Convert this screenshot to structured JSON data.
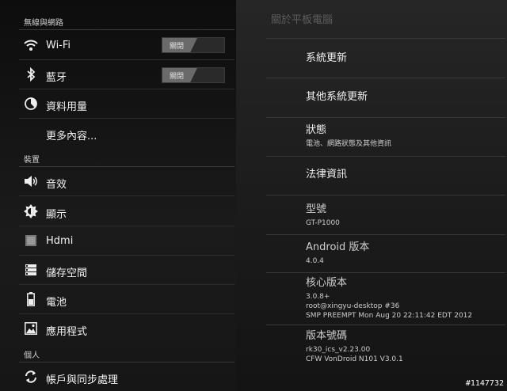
{
  "sidebar": {
    "wireless_header": "無線與網路",
    "device_header": "裝置",
    "personal_header": "個人",
    "items": [
      {
        "label": "Wi-Fi",
        "icon": "wifi-icon",
        "toggle": "關閉"
      },
      {
        "label": "藍牙",
        "icon": "bluetooth-icon",
        "toggle": "關閉"
      },
      {
        "label": "資料用量",
        "icon": "data-usage-icon"
      },
      {
        "label": "更多內容..."
      },
      {
        "label": "音效",
        "icon": "speaker-icon"
      },
      {
        "label": "顯示",
        "icon": "brightness-icon"
      },
      {
        "label": "Hdmi",
        "icon": "hdmi-icon"
      },
      {
        "label": "儲存空間",
        "icon": "storage-icon"
      },
      {
        "label": "電池",
        "icon": "battery-icon"
      },
      {
        "label": "應用程式",
        "icon": "apps-icon"
      },
      {
        "label": "帳戶與同步處理",
        "icon": "sync-icon"
      }
    ]
  },
  "main": {
    "title": "關於平板電腦",
    "items": [
      {
        "title": "系統更新"
      },
      {
        "title": "其他系統更新"
      },
      {
        "title": "狀態",
        "sub": "電池、網路狀態及其他資訊"
      },
      {
        "title": "法律資訊"
      },
      {
        "title": "型號",
        "sub": "GT-P1000"
      },
      {
        "title": "Android 版本",
        "sub": "4.0.4"
      },
      {
        "title": "核心版本",
        "sub": "3.0.8+",
        "sub2": "root@xingyu-desktop #36",
        "sub3": "SMP PREEMPT Mon Aug 20 22:11:42 EDT 2012"
      },
      {
        "title": "版本號碼",
        "sub": "rk30_ics_v2.23.00",
        "sub2": "CFW VonDroid N101 V3.0.1"
      }
    ]
  },
  "watermark": "#1147732"
}
